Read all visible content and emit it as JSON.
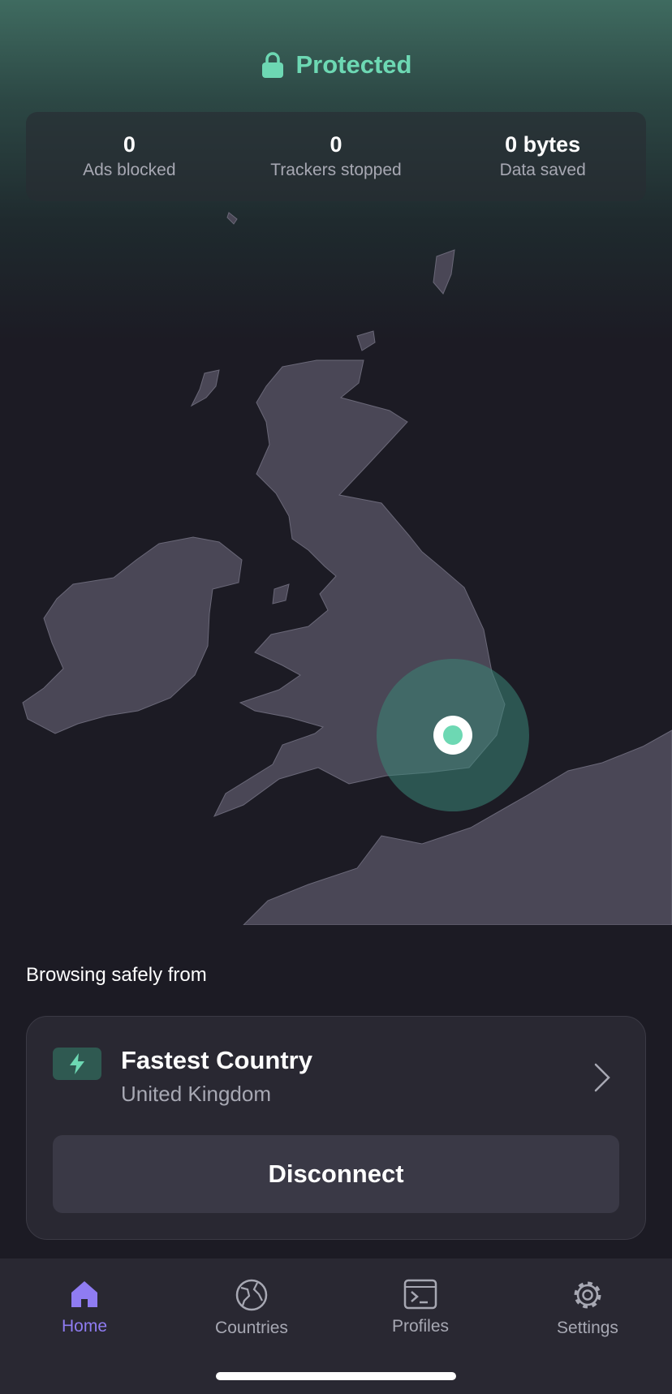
{
  "status": {
    "text": "Protected",
    "icon": "lock-icon",
    "color": "#6dd8b3"
  },
  "stats": [
    {
      "value": "0",
      "label": "Ads blocked"
    },
    {
      "value": "0",
      "label": "Trackers stopped"
    },
    {
      "value": "0 bytes",
      "label": "Data saved"
    }
  ],
  "map": {
    "location_icon": "location-pin-icon"
  },
  "connection": {
    "heading": "Browsing safely from",
    "server_name": "Fastest Country",
    "country": "United Kingdom",
    "server_icon": "bolt-icon",
    "disconnect_label": "Disconnect"
  },
  "tabs": [
    {
      "label": "Home",
      "icon": "home-icon",
      "active": true
    },
    {
      "label": "Countries",
      "icon": "globe-icon",
      "active": false
    },
    {
      "label": "Profiles",
      "icon": "terminal-icon",
      "active": false
    },
    {
      "label": "Settings",
      "icon": "gear-icon",
      "active": false
    }
  ],
  "colors": {
    "accent": "#8f7cf2",
    "background": "#1c1b24",
    "land": "#4a4756"
  }
}
